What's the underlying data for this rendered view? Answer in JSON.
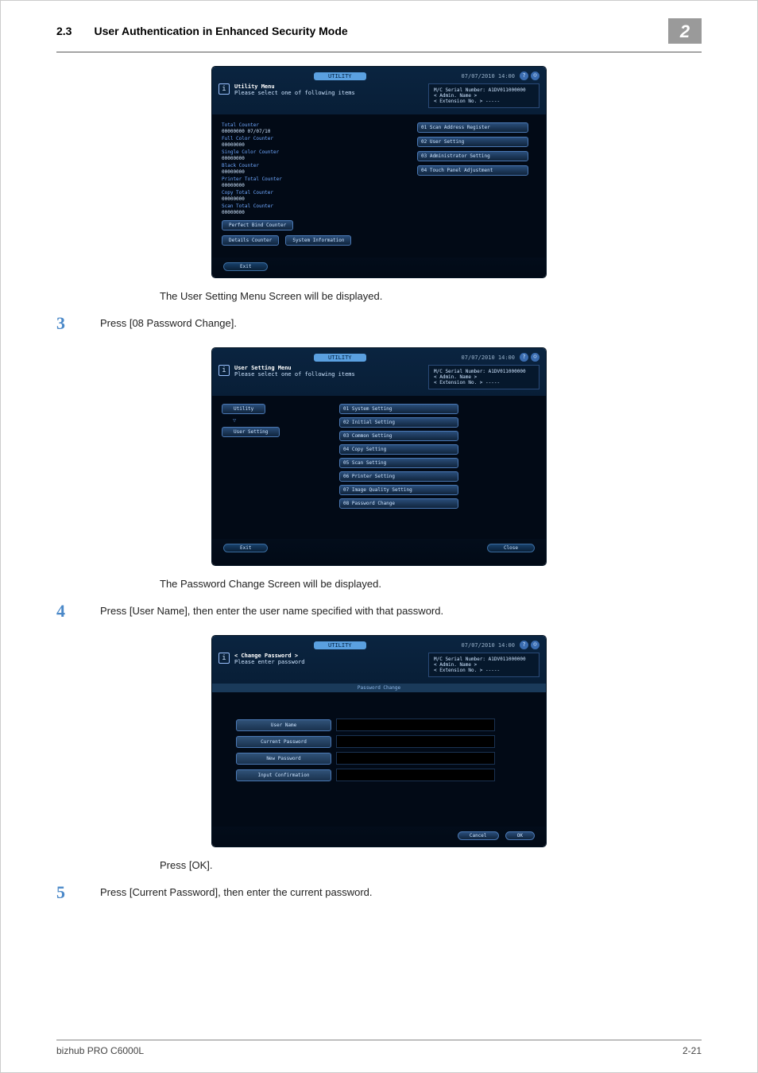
{
  "header": {
    "secno": "2.3",
    "title": "User Authentication in Enhanced Security Mode",
    "page_badge": "2"
  },
  "footer": {
    "product": "bizhub PRO C6000L",
    "page": "2-21"
  },
  "sc_common": {
    "chip": "UTILITY",
    "date": "07/07/2010 14:00",
    "serial": "M/C Serial Number: A1DV011000000",
    "admin": "< Admin. Name >",
    "ext": "< Extension No. >  -----"
  },
  "sc1": {
    "info_title": "Utility Menu",
    "info_sub": "Please select one of following items",
    "counters": [
      {
        "label": "Total Counter",
        "value": "00000000   07/07/10"
      },
      {
        "label": "Full Color Counter",
        "value": "00000000"
      },
      {
        "label": "Single Color Counter",
        "value": "00000000"
      },
      {
        "label": "Black Counter",
        "value": "00000000"
      },
      {
        "label": "Printer Total Counter",
        "value": "00000000"
      },
      {
        "label": "Copy Total Counter",
        "value": "00000000"
      },
      {
        "label": "Scan Total Counter",
        "value": "00000000"
      }
    ],
    "right": [
      "01 Scan Address Register",
      "02 User Setting",
      "03 Administrator Setting",
      "04 Touch Panel Adjustment"
    ],
    "bottom1": "Perfect Bind Counter",
    "bottom2": "Details Counter",
    "bottom3": "System Information",
    "exit": "Exit"
  },
  "text1": "The User Setting Menu Screen will be displayed.",
  "step3": {
    "no": "3",
    "txt": "Press [08 Password Change]."
  },
  "sc2": {
    "info_title": "User Setting Menu",
    "info_sub": "Please select one of following items",
    "crumb1": "Utility",
    "crumb2": "User Setting",
    "menu": [
      "01 System Setting",
      "02 Initial Setting",
      "03 Common Setting",
      "04 Copy Setting",
      "05 Scan Setting",
      "06 Printer Setting",
      "07 Image Quality Setting",
      "08 Password Change"
    ],
    "exit": "Exit",
    "close": "Close"
  },
  "text2": "The Password Change Screen will be displayed.",
  "step4": {
    "no": "4",
    "txt": "Press [User Name], then enter the user name specified with that password."
  },
  "sc3": {
    "info_title": "< Change Password >",
    "info_sub": "Please enter password",
    "tab": "Password Change",
    "fields": [
      "User Name",
      "Current Password",
      "New Password",
      "Input Confirmation"
    ],
    "cancel": "Cancel",
    "ok": "OK"
  },
  "text3": "Press [OK].",
  "step5": {
    "no": "5",
    "txt": "Press [Current Password], then enter the current password."
  }
}
